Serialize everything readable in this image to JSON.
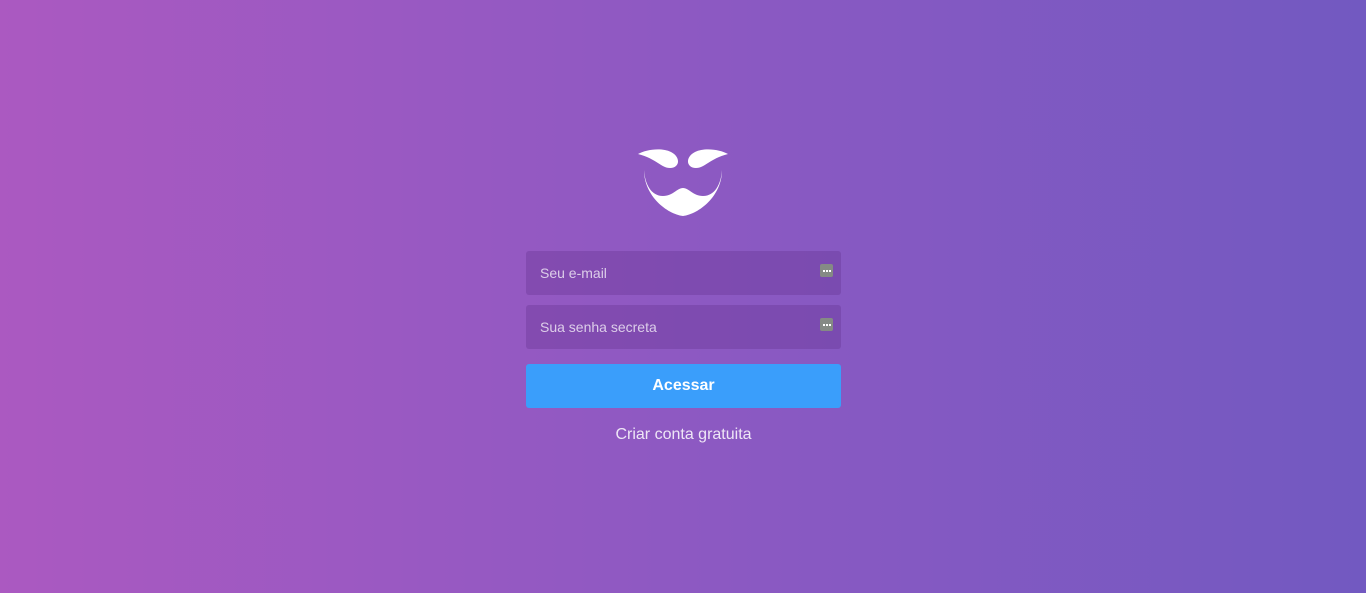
{
  "logo": {
    "icon": "mustache-beard-icon",
    "color": "#ffffff"
  },
  "login": {
    "email_placeholder": "Seu e-mail",
    "password_placeholder": "Sua senha secreta",
    "submit_label": "Acessar",
    "signup_link": "Criar conta gratuita"
  },
  "colors": {
    "gradient_start": "#ab59c1",
    "gradient_end": "#7259c1",
    "button": "#3a9efb"
  }
}
